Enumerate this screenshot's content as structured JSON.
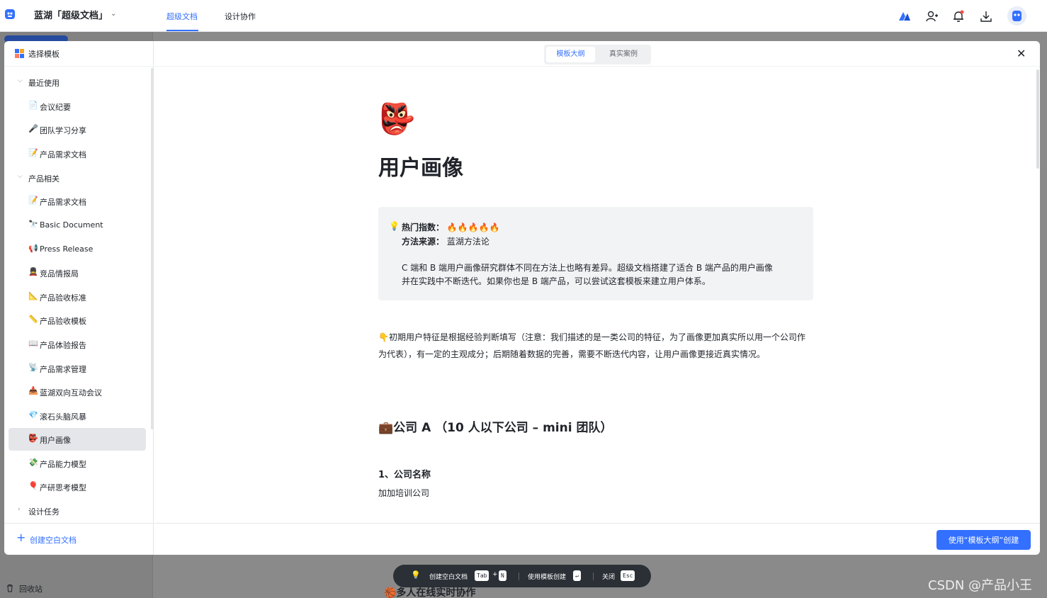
{
  "topbar": {
    "workspace": "蓝湖「超级文档」",
    "tabs": [
      {
        "label": "超级文档",
        "active": true
      },
      {
        "label": "设计协作",
        "active": false
      }
    ],
    "icons": [
      "lanhu-logo-icon",
      "add-member-icon",
      "bell-icon",
      "download-icon",
      "avatar"
    ]
  },
  "modal": {
    "side_title": "选择模板",
    "groups": [
      {
        "label": "最近使用",
        "expanded": true,
        "items": [
          {
            "icon": "📄",
            "label": "会议纪要"
          },
          {
            "icon": "🎤",
            "label": "团队学习分享"
          },
          {
            "icon": "📝",
            "label": "产品需求文档"
          }
        ]
      },
      {
        "label": "产品相关",
        "expanded": true,
        "items": [
          {
            "icon": "📝",
            "label": "产品需求文档"
          },
          {
            "icon": "🔭",
            "label": "Basic Document"
          },
          {
            "icon": "📢",
            "label": "Press Release"
          },
          {
            "icon": "💂",
            "label": "竞品情报局"
          },
          {
            "icon": "📐",
            "label": "产品验收标准"
          },
          {
            "icon": "📏",
            "label": "产品验收模板"
          },
          {
            "icon": "📖",
            "label": "产品体验报告"
          },
          {
            "icon": "📡",
            "label": "产品需求管理"
          },
          {
            "icon": "📥",
            "label": "蓝湖双向互动会议"
          },
          {
            "icon": "💎",
            "label": "滚石头脑风暴"
          },
          {
            "icon": "👺",
            "label": "用户画像",
            "selected": true
          },
          {
            "icon": "💸",
            "label": "产品能力模型"
          },
          {
            "icon": "🎈",
            "label": "产研思考模型"
          }
        ]
      },
      {
        "label": "设计任务",
        "expanded": false,
        "items": []
      }
    ],
    "create_blank": "创建空白文档",
    "tabs": [
      {
        "label": "模板大纲",
        "active": true
      },
      {
        "label": "真实案例",
        "active": false
      }
    ],
    "use_button": "使用“模板大纲”创建"
  },
  "doc": {
    "emoji": "👺",
    "title": "用户画像",
    "callout": {
      "hot_key": "热门指数：",
      "hot_value": "🔥🔥🔥🔥🔥",
      "source_key": "方法来源：",
      "source_value": "蓝湖方法论",
      "desc_line1": "C 端和 B 端用户画像研究群体不同在方法上也略有差异。超级文档搭建了适合 B 端产品的用户画像",
      "desc_line2": "并在实践中不断迭代。如果你也是 B 端产品，可以尝试这套模板来建立用户体系。"
    },
    "paragraph": "👇初期用户特征是根据经验判断填写（注意：我们描述的是一类公司的特征，为了画像更加真实所以用一个公司作为代表），有一定的主观成分；后期随着数据的完善，需要不断迭代内容，让用户画像更接近真实情况。",
    "heading2": "💼公司 A （10 人以下公司 – mini 团队）",
    "heading3": "1、公司名称",
    "company_name": "加加培训公司"
  },
  "shortcuts": {
    "create_blank": "创建空白文档",
    "tab_key": "Tab",
    "plus": "+",
    "n_key": "N",
    "use_template": "使用模板创建",
    "enter_key": "↵",
    "close": "关闭",
    "esc_key": "Esc"
  },
  "background": {
    "recycle": "回收站",
    "underlying_heading": "🏀多人在线实时协作"
  },
  "watermark": "CSDN @产品小王"
}
